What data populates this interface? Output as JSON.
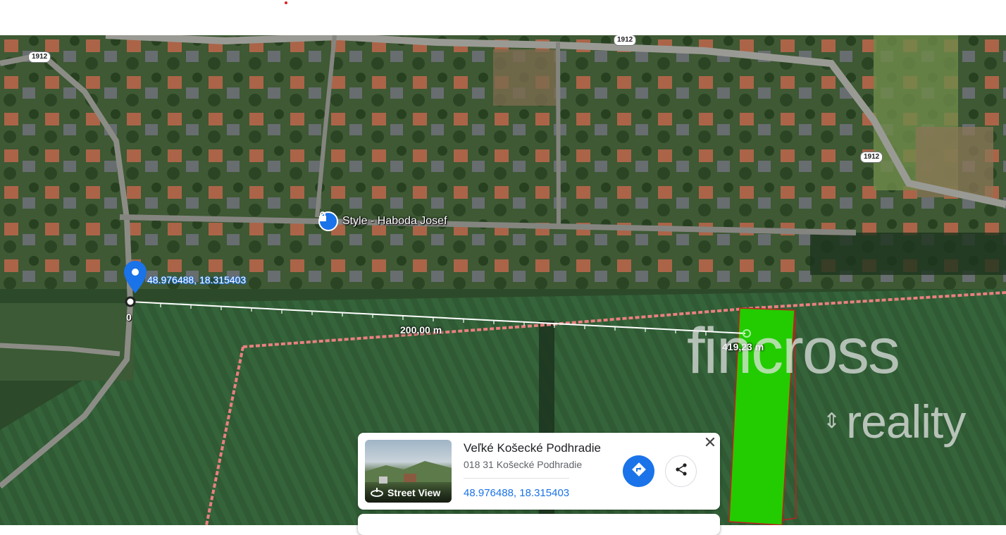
{
  "map": {
    "road_number": "1912",
    "poi_label": "Style - Haboda Josef",
    "pin_coordinates": "48.976488, 18.315403",
    "measure": {
      "start_label": "0",
      "mid_label": "200,00 m",
      "end_label": "419,23 m"
    },
    "icons": [
      "location-pin-icon",
      "lock-bag-icon",
      "street-view-icon",
      "directions-icon",
      "share-icon",
      "close-icon"
    ],
    "colors": {
      "pin": "#1a73e8",
      "plot_fill": "#22cc00",
      "boundary": "#e98080"
    }
  },
  "watermark": {
    "line1": "fincross",
    "line2": "reality"
  },
  "place_card": {
    "title": "Veľké Košecké Podhradie",
    "address": "018 31 Košecké Podhradie",
    "coordinates": "48.976488, 18.315403",
    "street_view_label": "Street View",
    "close_symbol": "✕"
  }
}
